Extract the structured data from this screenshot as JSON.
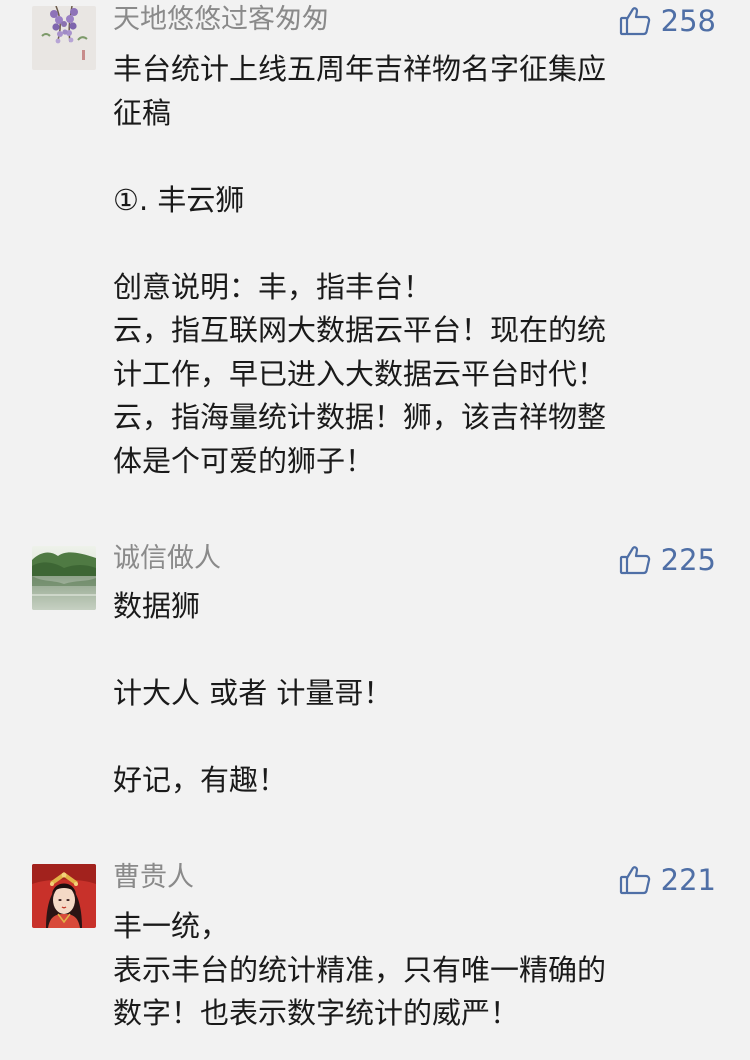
{
  "comments": [
    {
      "nickname": "天地悠悠过客匆匆",
      "likes": "258",
      "lines": [
        "丰台统计上线五周年吉祥物名字征集应",
        "征稿",
        "",
        "①. 丰云狮",
        "",
        "创意说明：丰，指丰台！",
        "云，指互联网大数据云平台！现在的统",
        "计工作，早已进入大数据云平台时代！",
        "云，指海量统计数据！狮，该吉祥物整",
        "体是个可爱的狮子！"
      ]
    },
    {
      "nickname": "诚信做人",
      "likes": "225",
      "lines": [
        "数据狮",
        "",
        "计大人 或者 计量哥！",
        "",
        "好记，有趣！"
      ]
    },
    {
      "nickname": "曹贵人",
      "likes": "221",
      "lines": [
        "丰一统，",
        "表示丰台的统计精准，只有唯一精确的",
        "数字！也表示数字统计的威严！"
      ]
    }
  ]
}
